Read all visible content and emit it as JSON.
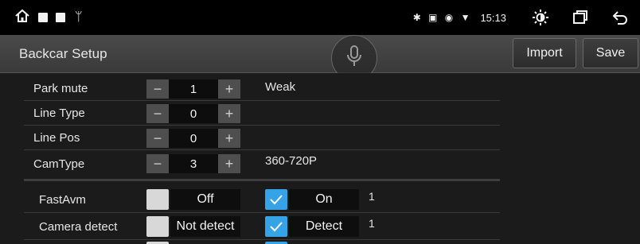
{
  "statusbar": {
    "time": "15:13",
    "status_icons": "✱ ▣ ◉ ▼"
  },
  "appbar": {
    "title": "Backcar Setup",
    "import_label": "Import",
    "save_label": "Save"
  },
  "settings": [
    {
      "label": "Park mute",
      "value": "1",
      "extra": "Weak"
    },
    {
      "label": "Line Type",
      "value": "0",
      "extra": ""
    },
    {
      "label": "Line Pos",
      "value": "0",
      "extra": ""
    },
    {
      "label": "CamType",
      "value": "3",
      "extra": "360-720P"
    }
  ],
  "stepper": {
    "minus": "−",
    "plus": "+"
  },
  "options": [
    {
      "label": "FastAvm",
      "off_label": "Off",
      "on_label": "On",
      "selected": "on",
      "count": "1"
    },
    {
      "label": "Camera detect",
      "off_label": "Not detect",
      "on_label": "Detect",
      "selected": "on",
      "count": "1"
    }
  ],
  "colors": {
    "accent": "#36a3e6",
    "background": "#1b1b1b",
    "statusbar": "#000000"
  }
}
